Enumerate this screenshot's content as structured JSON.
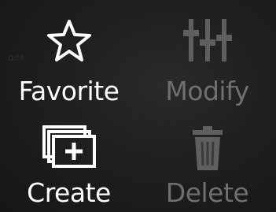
{
  "actions": {
    "favorite": {
      "label": "Favorite",
      "icon": "star-icon",
      "enabled": true
    },
    "modify": {
      "label": "Modify",
      "icon": "sliders-icon",
      "enabled": false
    },
    "create": {
      "label": "Create",
      "icon": "add-copy-icon",
      "enabled": true
    },
    "delete": {
      "label": "Delete",
      "icon": "trash-icon",
      "enabled": false
    }
  },
  "background_hint": "oes",
  "colors": {
    "enabled_text": "#ffffff",
    "disabled_text": "#6f6f6f",
    "background": "#1f1f1f"
  }
}
